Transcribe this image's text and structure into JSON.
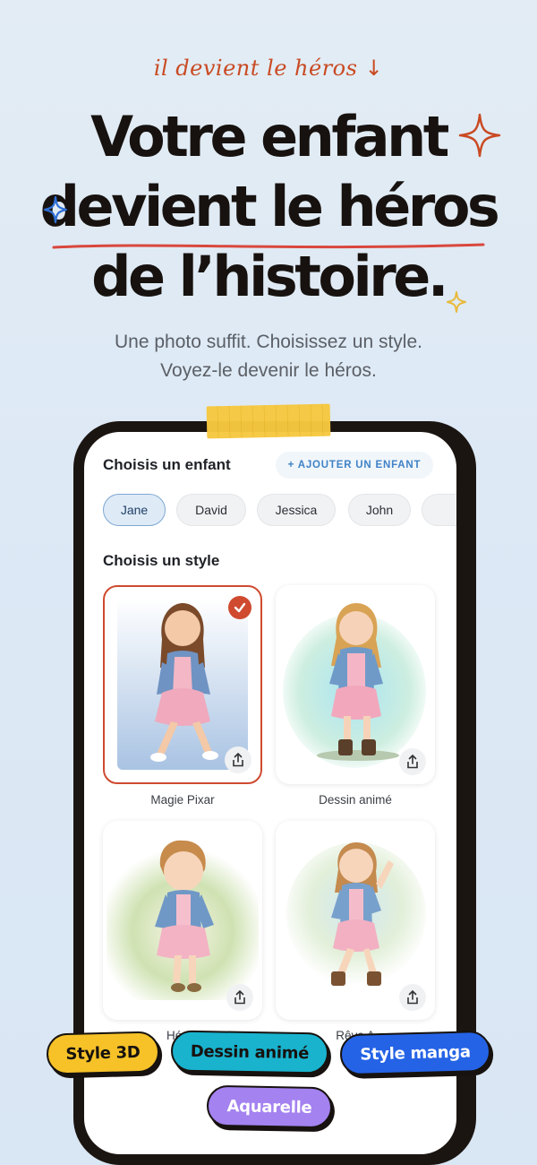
{
  "hero": {
    "tagline": "il devient le héros",
    "tagline_arrow": "↓",
    "headline_lines": [
      "Votre enfant",
      "devient le héros",
      "de l’histoire."
    ],
    "subtitle_lines": [
      "Une photo suffit. Choisissez un style.",
      "Voyez-le devenir le héros."
    ]
  },
  "app": {
    "child_section_title": "Choisis un enfant",
    "add_child_label": "+ AJOUTER UN ENFANT",
    "children": [
      "Jane",
      "David",
      "Jessica",
      "John"
    ],
    "selected_child": "Jane",
    "style_section_title": "Choisis un style",
    "styles": [
      {
        "label": "Magie Pixar",
        "selected": true
      },
      {
        "label": "Dessin animé",
        "selected": false
      },
      {
        "label": "Héros",
        "selected": false
      },
      {
        "label": "Rêve A",
        "selected": false
      }
    ]
  },
  "badges": {
    "style_3d": "Style 3D",
    "cartoon": "Dessin animé",
    "manga": "Style manga",
    "watercolor": "Aquarelle"
  },
  "colors": {
    "accent_red": "#cf4a2f",
    "link_blue": "#3f82c7",
    "badge_yellow": "#f6c228",
    "badge_cyan": "#19b3ce",
    "badge_blue": "#2563e6",
    "badge_purple": "#a482f0"
  },
  "icons": [
    "sparkle-icon",
    "share-icon",
    "check-icon",
    "arrow-down-icon"
  ]
}
